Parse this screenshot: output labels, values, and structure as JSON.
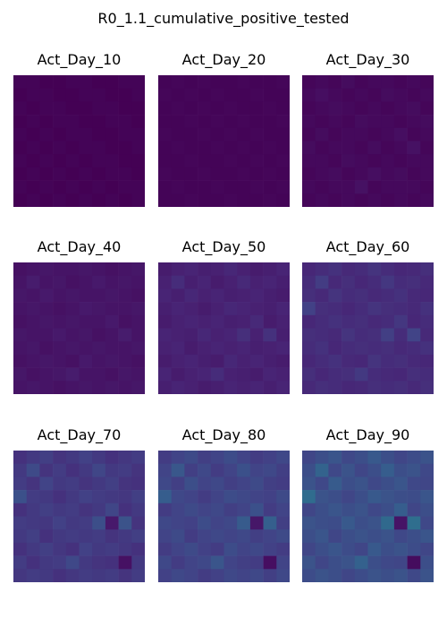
{
  "chart_data": {
    "type": "heatmap",
    "title": "R0_1.1_cumulative_positive_tested",
    "colormap": "viridis",
    "value_range": [
      0,
      1
    ],
    "grid": false,
    "axes_visible": false,
    "layout": {
      "rows": 3,
      "cols": 3
    },
    "panels": [
      {
        "title": "Act_Day_10",
        "values": [
          [
            0.01,
            0.01,
            0.0,
            0.0,
            0.01,
            0.01,
            0.0,
            0.0,
            0.01,
            0.01
          ],
          [
            0.0,
            0.01,
            0.01,
            0.0,
            0.0,
            0.01,
            0.01,
            0.0,
            0.0,
            0.01
          ],
          [
            0.01,
            0.0,
            0.01,
            0.01,
            0.0,
            0.0,
            0.01,
            0.01,
            0.0,
            0.0
          ],
          [
            0.0,
            0.01,
            0.0,
            0.01,
            0.01,
            0.0,
            0.0,
            0.01,
            0.01,
            0.0
          ],
          [
            0.01,
            0.0,
            0.01,
            0.0,
            0.01,
            0.01,
            0.0,
            0.0,
            0.01,
            0.01
          ],
          [
            0.0,
            0.01,
            0.0,
            0.01,
            0.0,
            0.01,
            0.01,
            0.0,
            0.0,
            0.01
          ],
          [
            0.01,
            0.0,
            0.01,
            0.0,
            0.01,
            0.0,
            0.01,
            0.01,
            0.0,
            0.0
          ],
          [
            0.0,
            0.01,
            0.0,
            0.01,
            0.0,
            0.01,
            0.0,
            0.01,
            0.01,
            0.0
          ],
          [
            0.01,
            0.0,
            0.01,
            0.0,
            0.01,
            0.0,
            0.01,
            0.0,
            0.01,
            0.01
          ],
          [
            0.0,
            0.01,
            0.0,
            0.01,
            0.0,
            0.01,
            0.0,
            0.01,
            0.0,
            0.01
          ]
        ]
      },
      {
        "title": "Act_Day_20",
        "values": [
          [
            0.01,
            0.02,
            0.01,
            0.02,
            0.01,
            0.01,
            0.02,
            0.01,
            0.01,
            0.02
          ],
          [
            0.02,
            0.01,
            0.02,
            0.01,
            0.02,
            0.01,
            0.01,
            0.02,
            0.01,
            0.01
          ],
          [
            0.01,
            0.02,
            0.01,
            0.02,
            0.01,
            0.02,
            0.01,
            0.01,
            0.02,
            0.01
          ],
          [
            0.01,
            0.01,
            0.02,
            0.01,
            0.02,
            0.01,
            0.02,
            0.01,
            0.01,
            0.02
          ],
          [
            0.02,
            0.01,
            0.01,
            0.02,
            0.01,
            0.02,
            0.01,
            0.02,
            0.01,
            0.01
          ],
          [
            0.01,
            0.02,
            0.01,
            0.01,
            0.02,
            0.01,
            0.02,
            0.01,
            0.02,
            0.01
          ],
          [
            0.01,
            0.01,
            0.02,
            0.01,
            0.01,
            0.02,
            0.01,
            0.02,
            0.01,
            0.02
          ],
          [
            0.02,
            0.01,
            0.01,
            0.02,
            0.01,
            0.01,
            0.02,
            0.01,
            0.02,
            0.01
          ],
          [
            0.01,
            0.02,
            0.01,
            0.01,
            0.02,
            0.01,
            0.01,
            0.02,
            0.01,
            0.02
          ],
          [
            0.01,
            0.01,
            0.02,
            0.01,
            0.01,
            0.02,
            0.01,
            0.01,
            0.02,
            0.01
          ]
        ]
      },
      {
        "title": "Act_Day_30",
        "values": [
          [
            0.02,
            0.03,
            0.02,
            0.04,
            0.02,
            0.03,
            0.03,
            0.02,
            0.03,
            0.02
          ],
          [
            0.03,
            0.05,
            0.03,
            0.02,
            0.03,
            0.02,
            0.04,
            0.03,
            0.02,
            0.03
          ],
          [
            0.02,
            0.03,
            0.04,
            0.03,
            0.02,
            0.03,
            0.02,
            0.03,
            0.04,
            0.02
          ],
          [
            0.03,
            0.02,
            0.03,
            0.02,
            0.04,
            0.03,
            0.03,
            0.02,
            0.03,
            0.04
          ],
          [
            0.02,
            0.04,
            0.02,
            0.03,
            0.03,
            0.02,
            0.03,
            0.05,
            0.02,
            0.03
          ],
          [
            0.04,
            0.02,
            0.03,
            0.03,
            0.02,
            0.04,
            0.02,
            0.03,
            0.06,
            0.02
          ],
          [
            0.03,
            0.03,
            0.02,
            0.04,
            0.03,
            0.02,
            0.03,
            0.02,
            0.03,
            0.03
          ],
          [
            0.02,
            0.03,
            0.04,
            0.02,
            0.03,
            0.05,
            0.03,
            0.04,
            0.02,
            0.03
          ],
          [
            0.03,
            0.02,
            0.03,
            0.03,
            0.06,
            0.02,
            0.03,
            0.03,
            0.03,
            0.02
          ],
          [
            0.02,
            0.03,
            0.02,
            0.03,
            0.02,
            0.03,
            0.02,
            0.03,
            0.02,
            0.03
          ]
        ]
      },
      {
        "title": "Act_Day_40",
        "values": [
          [
            0.06,
            0.07,
            0.08,
            0.07,
            0.07,
            0.08,
            0.07,
            0.06,
            0.07,
            0.08
          ],
          [
            0.07,
            0.1,
            0.07,
            0.08,
            0.06,
            0.07,
            0.09,
            0.07,
            0.08,
            0.07
          ],
          [
            0.08,
            0.07,
            0.09,
            0.07,
            0.08,
            0.07,
            0.07,
            0.08,
            0.07,
            0.06
          ],
          [
            0.07,
            0.08,
            0.07,
            0.06,
            0.07,
            0.09,
            0.08,
            0.07,
            0.07,
            0.08
          ],
          [
            0.06,
            0.07,
            0.08,
            0.07,
            0.08,
            0.07,
            0.07,
            0.09,
            0.06,
            0.07
          ],
          [
            0.08,
            0.07,
            0.07,
            0.09,
            0.07,
            0.08,
            0.06,
            0.07,
            0.1,
            0.07
          ],
          [
            0.07,
            0.08,
            0.06,
            0.07,
            0.08,
            0.07,
            0.08,
            0.07,
            0.07,
            0.08
          ],
          [
            0.06,
            0.07,
            0.08,
            0.07,
            0.06,
            0.09,
            0.07,
            0.08,
            0.07,
            0.06
          ],
          [
            0.08,
            0.06,
            0.07,
            0.08,
            0.1,
            0.07,
            0.07,
            0.06,
            0.08,
            0.07
          ],
          [
            0.07,
            0.08,
            0.07,
            0.06,
            0.07,
            0.08,
            0.07,
            0.08,
            0.07,
            0.08
          ]
        ]
      },
      {
        "title": "Act_Day_50",
        "values": [
          [
            0.1,
            0.12,
            0.13,
            0.11,
            0.12,
            0.14,
            0.12,
            0.1,
            0.11,
            0.13
          ],
          [
            0.12,
            0.16,
            0.11,
            0.13,
            0.1,
            0.12,
            0.15,
            0.12,
            0.13,
            0.11
          ],
          [
            0.13,
            0.11,
            0.14,
            0.12,
            0.13,
            0.11,
            0.12,
            0.13,
            0.11,
            0.1
          ],
          [
            0.11,
            0.13,
            0.12,
            0.1,
            0.12,
            0.14,
            0.13,
            0.12,
            0.11,
            0.13
          ],
          [
            0.1,
            0.12,
            0.13,
            0.12,
            0.13,
            0.11,
            0.12,
            0.15,
            0.1,
            0.12
          ],
          [
            0.13,
            0.12,
            0.11,
            0.14,
            0.12,
            0.13,
            0.17,
            0.12,
            0.18,
            0.11
          ],
          [
            0.12,
            0.13,
            0.1,
            0.12,
            0.13,
            0.12,
            0.13,
            0.11,
            0.12,
            0.13
          ],
          [
            0.1,
            0.12,
            0.13,
            0.11,
            0.1,
            0.14,
            0.12,
            0.13,
            0.11,
            0.1
          ],
          [
            0.13,
            0.1,
            0.12,
            0.13,
            0.16,
            0.12,
            0.11,
            0.1,
            0.13,
            0.12
          ],
          [
            0.11,
            0.13,
            0.12,
            0.1,
            0.11,
            0.13,
            0.12,
            0.13,
            0.11,
            0.13
          ]
        ]
      },
      {
        "title": "Act_Day_60",
        "values": [
          [
            0.14,
            0.16,
            0.18,
            0.15,
            0.16,
            0.19,
            0.16,
            0.14,
            0.15,
            0.17
          ],
          [
            0.16,
            0.22,
            0.15,
            0.17,
            0.14,
            0.16,
            0.2,
            0.16,
            0.17,
            0.15
          ],
          [
            0.17,
            0.15,
            0.19,
            0.16,
            0.17,
            0.15,
            0.16,
            0.18,
            0.15,
            0.14
          ],
          [
            0.24,
            0.17,
            0.16,
            0.14,
            0.16,
            0.19,
            0.17,
            0.16,
            0.15,
            0.18
          ],
          [
            0.14,
            0.16,
            0.18,
            0.16,
            0.17,
            0.15,
            0.16,
            0.2,
            0.14,
            0.16
          ],
          [
            0.17,
            0.16,
            0.15,
            0.19,
            0.16,
            0.17,
            0.23,
            0.16,
            0.25,
            0.15
          ],
          [
            0.16,
            0.18,
            0.14,
            0.16,
            0.17,
            0.16,
            0.17,
            0.15,
            0.16,
            0.18
          ],
          [
            0.14,
            0.16,
            0.18,
            0.15,
            0.14,
            0.19,
            0.16,
            0.17,
            0.15,
            0.14
          ],
          [
            0.17,
            0.14,
            0.16,
            0.17,
            0.21,
            0.16,
            0.15,
            0.14,
            0.17,
            0.16
          ],
          [
            0.15,
            0.17,
            0.16,
            0.14,
            0.15,
            0.17,
            0.16,
            0.17,
            0.15,
            0.17
          ]
        ]
      },
      {
        "title": "Act_Day_70",
        "values": [
          [
            0.18,
            0.21,
            0.23,
            0.19,
            0.21,
            0.24,
            0.21,
            0.18,
            0.2,
            0.22
          ],
          [
            0.21,
            0.28,
            0.19,
            0.22,
            0.18,
            0.21,
            0.26,
            0.21,
            0.22,
            0.19
          ],
          [
            0.22,
            0.19,
            0.25,
            0.21,
            0.22,
            0.19,
            0.21,
            0.23,
            0.19,
            0.18
          ],
          [
            0.31,
            0.22,
            0.21,
            0.18,
            0.21,
            0.24,
            0.22,
            0.21,
            0.2,
            0.23
          ],
          [
            0.18,
            0.21,
            0.23,
            0.21,
            0.22,
            0.19,
            0.21,
            0.26,
            0.18,
            0.21
          ],
          [
            0.22,
            0.21,
            0.2,
            0.24,
            0.21,
            0.22,
            0.3,
            0.09,
            0.32,
            0.19
          ],
          [
            0.21,
            0.23,
            0.18,
            0.21,
            0.22,
            0.21,
            0.22,
            0.19,
            0.21,
            0.23
          ],
          [
            0.18,
            0.21,
            0.23,
            0.2,
            0.18,
            0.24,
            0.21,
            0.22,
            0.2,
            0.18
          ],
          [
            0.22,
            0.18,
            0.21,
            0.22,
            0.27,
            0.21,
            0.19,
            0.18,
            0.06,
            0.21
          ],
          [
            0.2,
            0.22,
            0.21,
            0.18,
            0.2,
            0.22,
            0.21,
            0.22,
            0.19,
            0.22
          ]
        ]
      },
      {
        "title": "Act_Day_80",
        "values": [
          [
            0.22,
            0.25,
            0.28,
            0.23,
            0.25,
            0.29,
            0.25,
            0.22,
            0.24,
            0.27
          ],
          [
            0.25,
            0.34,
            0.23,
            0.27,
            0.22,
            0.25,
            0.31,
            0.25,
            0.27,
            0.23
          ],
          [
            0.27,
            0.23,
            0.3,
            0.25,
            0.27,
            0.23,
            0.25,
            0.28,
            0.23,
            0.22
          ],
          [
            0.37,
            0.27,
            0.25,
            0.22,
            0.25,
            0.29,
            0.27,
            0.25,
            0.24,
            0.28
          ],
          [
            0.22,
            0.25,
            0.28,
            0.25,
            0.27,
            0.23,
            0.25,
            0.31,
            0.22,
            0.25
          ],
          [
            0.27,
            0.25,
            0.24,
            0.29,
            0.25,
            0.27,
            0.36,
            0.08,
            0.38,
            0.23
          ],
          [
            0.25,
            0.28,
            0.22,
            0.25,
            0.27,
            0.25,
            0.27,
            0.23,
            0.25,
            0.28
          ],
          [
            0.22,
            0.25,
            0.28,
            0.24,
            0.22,
            0.29,
            0.25,
            0.27,
            0.24,
            0.22
          ],
          [
            0.27,
            0.22,
            0.25,
            0.27,
            0.33,
            0.25,
            0.23,
            0.22,
            0.05,
            0.25
          ],
          [
            0.24,
            0.27,
            0.25,
            0.22,
            0.24,
            0.27,
            0.25,
            0.27,
            0.23,
            0.27
          ]
        ]
      },
      {
        "title": "Act_Day_90",
        "values": [
          [
            0.26,
            0.3,
            0.33,
            0.27,
            0.3,
            0.35,
            0.3,
            0.26,
            0.29,
            0.32
          ],
          [
            0.3,
            0.4,
            0.27,
            0.32,
            0.26,
            0.3,
            0.37,
            0.3,
            0.32,
            0.27
          ],
          [
            0.32,
            0.27,
            0.36,
            0.3,
            0.32,
            0.27,
            0.3,
            0.33,
            0.27,
            0.26
          ],
          [
            0.44,
            0.32,
            0.3,
            0.26,
            0.3,
            0.35,
            0.32,
            0.3,
            0.29,
            0.33
          ],
          [
            0.26,
            0.3,
            0.33,
            0.3,
            0.32,
            0.27,
            0.3,
            0.37,
            0.26,
            0.3
          ],
          [
            0.32,
            0.3,
            0.29,
            0.35,
            0.3,
            0.32,
            0.43,
            0.07,
            0.45,
            0.27
          ],
          [
            0.3,
            0.33,
            0.26,
            0.3,
            0.32,
            0.3,
            0.32,
            0.27,
            0.3,
            0.33
          ],
          [
            0.26,
            0.3,
            0.33,
            0.29,
            0.26,
            0.35,
            0.3,
            0.32,
            0.29,
            0.26
          ],
          [
            0.32,
            0.26,
            0.3,
            0.32,
            0.39,
            0.3,
            0.27,
            0.26,
            0.04,
            0.3
          ],
          [
            0.29,
            0.32,
            0.3,
            0.26,
            0.29,
            0.32,
            0.3,
            0.32,
            0.27,
            0.32
          ]
        ]
      }
    ]
  }
}
